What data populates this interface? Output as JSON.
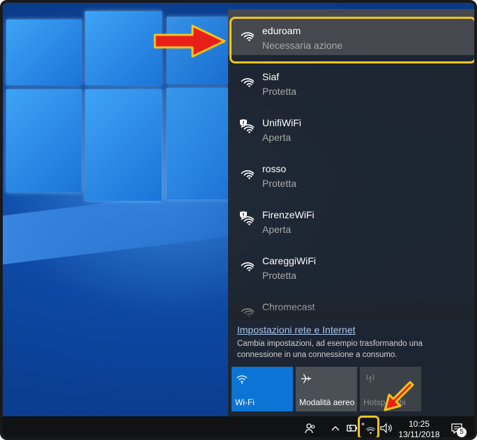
{
  "networks": [
    {
      "ssid": "eduroam",
      "state": "Necessaria azione",
      "secured_badge": false
    },
    {
      "ssid": "Siaf",
      "state": "Protetta",
      "secured_badge": false
    },
    {
      "ssid": "UnifiWiFi",
      "state": "Aperta",
      "secured_badge": true
    },
    {
      "ssid": "rosso",
      "state": "Protetta",
      "secured_badge": false
    },
    {
      "ssid": "FirenzeWiFi",
      "state": "Aperta",
      "secured_badge": true
    },
    {
      "ssid": "CareggiWiFi",
      "state": "Protetta",
      "secured_badge": false
    },
    {
      "ssid": "Chromecast",
      "state": "",
      "secured_badge": false
    }
  ],
  "settings": {
    "link": "Impostazioni rete e Internet",
    "description": "Cambia impostazioni, ad esempio trasformando una connessione in una connessione a consumo."
  },
  "quick_actions": [
    {
      "label": "Wi-Fi",
      "icon": "wifi-icon",
      "active": true
    },
    {
      "label": "Modalità aereo",
      "icon": "airplane-icon",
      "active": false
    },
    {
      "label": "Hotspot mobile",
      "label_visible": "Hotsp mobi",
      "icon": "hotspot-icon",
      "active": false,
      "disabled": true
    }
  ],
  "taskbar": {
    "time": "10:25",
    "date": "13/11/2018",
    "notification_count": "5"
  },
  "colors": {
    "accent": "#0c74d4",
    "highlight": "#f3c41a",
    "arrow_red": "#e8201a",
    "flyout_bg": "#1f242a"
  }
}
